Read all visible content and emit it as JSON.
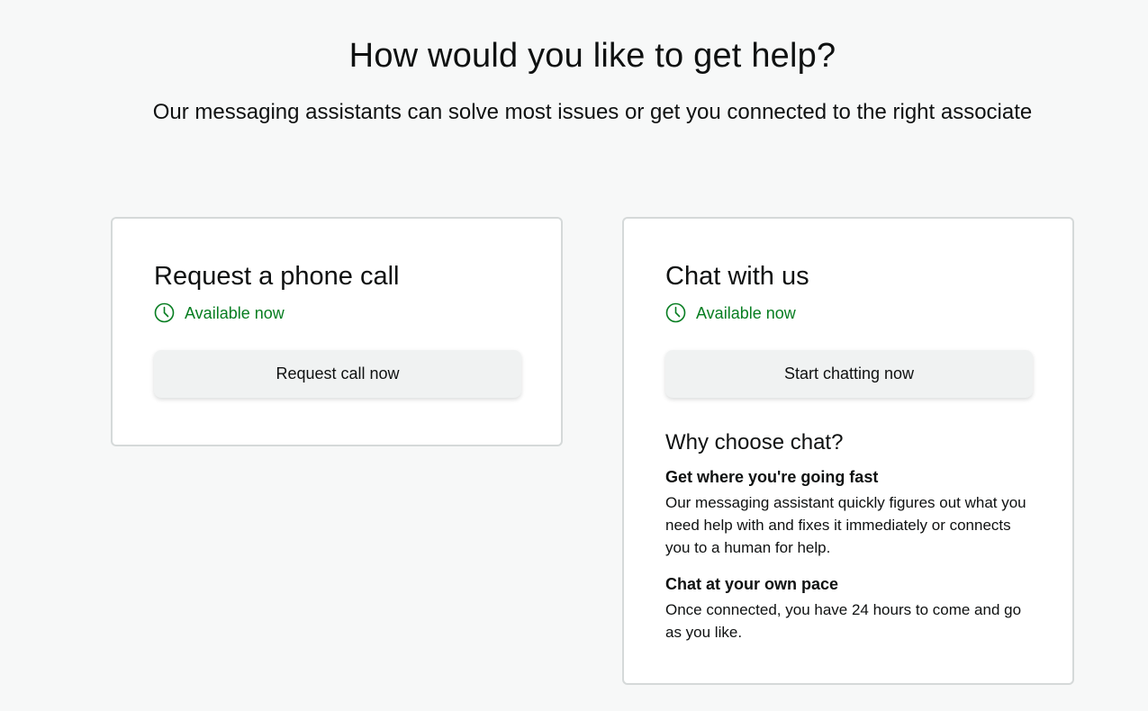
{
  "header": {
    "title": "How would you like to get help?",
    "subtitle": "Our messaging assistants can solve most issues or get you connected to the right associate"
  },
  "colors": {
    "available_green": "#067d20",
    "card_border": "#d5d9d9",
    "button_bg": "#f0f2f2",
    "page_bg": "#f7f8f8"
  },
  "phone_card": {
    "title": "Request a phone call",
    "status_icon": "clock-icon",
    "status": "Available now",
    "button_label": "Request call now"
  },
  "chat_card": {
    "title": "Chat with us",
    "status_icon": "clock-icon",
    "status": "Available now",
    "button_label": "Start chatting now",
    "why_title": "Why choose chat?",
    "reasons": [
      {
        "heading": "Get where you're going fast",
        "text": "Our messaging assistant quickly figures out what you need help with and fixes it immediately or connects you to a human for help."
      },
      {
        "heading": "Chat at your own pace",
        "text": "Once connected, you have 24 hours to come and go as you like."
      }
    ]
  }
}
